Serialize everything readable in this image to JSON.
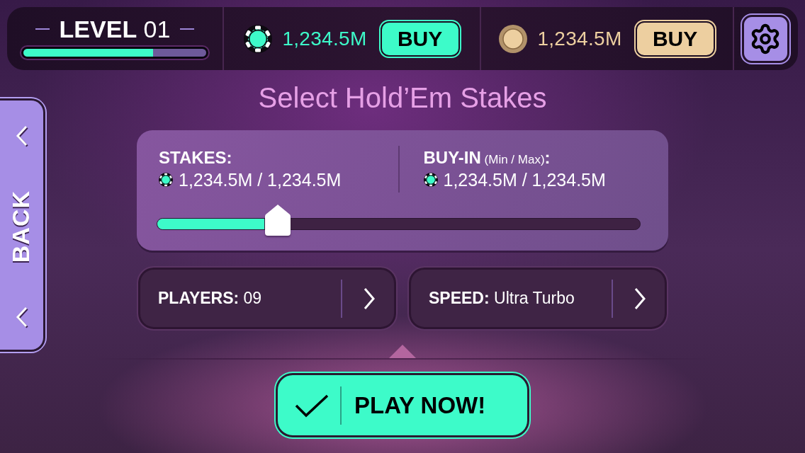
{
  "top_bar": {
    "level": {
      "label": "**LEVEL** 01",
      "level": 0.71
    },
    "currencies": [
      {
        "kind": "chips",
        "amount": "1,234.5M",
        "button": "BUY"
      },
      {
        "kind": "coins",
        "amount": "1,234.5M",
        "button": "BUY"
      }
    ]
  },
  "back_button": {
    "label": "BACK"
  },
  "title": "Select Hold’Em Stakes",
  "stakes_panel": {
    "stakes": {
      "heading": "STAKES:",
      "value": "1,234.5M / 1,234.5M"
    },
    "buy_in": {
      "heading": "**BUY-IN** (Min / Max)**:**",
      "value": "1,234.5M / 1,234.5M"
    },
    "slider": {
      "level": 0.25
    }
  },
  "options": [
    {
      "text": "**PLAYERS:** 09"
    },
    {
      "text": "**SPEED:** Ultra Turbo"
    }
  ],
  "play_button": {
    "label": "PLAY NOW!"
  }
}
